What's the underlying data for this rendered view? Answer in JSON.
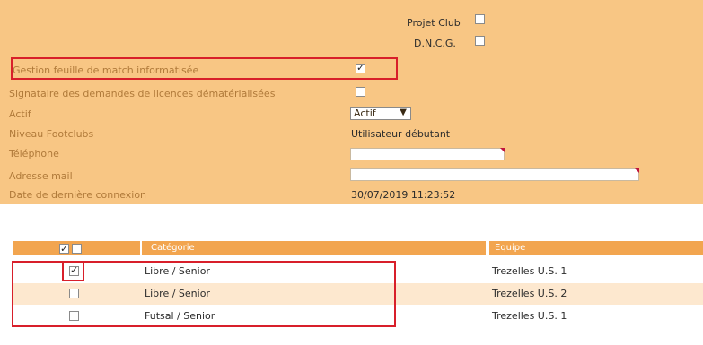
{
  "form": {
    "projet_club": {
      "label": "Projet Club",
      "checked": false
    },
    "dncg": {
      "label": "D.N.C.G.",
      "checked": false
    },
    "gestion_feuille": {
      "label": "Gestion feuille de match informatisée",
      "checked": true
    },
    "signataire": {
      "label": "Signataire des demandes de licences dématérialisées",
      "checked": false
    },
    "actif": {
      "label": "Actif",
      "value": "Actif"
    },
    "niveau": {
      "label": "Niveau Footclubs",
      "value": "Utilisateur débutant"
    },
    "telephone": {
      "label": "Téléphone",
      "value": ""
    },
    "adresse_mail": {
      "label": "Adresse mail",
      "value": ""
    },
    "derniere_connexion": {
      "label": "Date de dernière connexion",
      "value": "30/07/2019 11:23:52"
    }
  },
  "table": {
    "headers": {
      "categorie": "Catégorie",
      "equipe": "Equipe"
    },
    "rows": [
      {
        "categorie": "Libre / Senior",
        "equipe": "Trezelles U.S. 1",
        "checked": true
      },
      {
        "categorie": "Libre / Senior",
        "equipe": "Trezelles U.S. 2",
        "checked": false
      },
      {
        "categorie": "Futsal / Senior",
        "equipe": "Trezelles U.S. 1",
        "checked": false
      }
    ]
  },
  "colors": {
    "panel": "#f8c684",
    "header": "#f2a54f",
    "row_alt": "#fde8cf",
    "highlight": "#d81f2a"
  }
}
